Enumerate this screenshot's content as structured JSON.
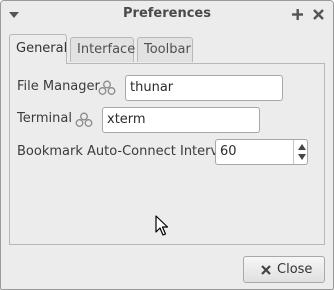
{
  "window": {
    "title": "Preferences"
  },
  "tabs": [
    {
      "label": "General",
      "active": true
    },
    {
      "label": "Interface",
      "active": false
    },
    {
      "label": "Toolbar",
      "active": false
    }
  ],
  "general": {
    "file_manager": {
      "label": "File Manager",
      "value": "thunar"
    },
    "terminal": {
      "label": "Terminal",
      "value": "xterm"
    },
    "bookmark_interval": {
      "label": "Bookmark Auto-Connect Interval",
      "value": "60"
    }
  },
  "footer": {
    "close_label": "Close"
  },
  "icons": {
    "window_menu": "chevron-down-icon",
    "maximize": "plus-icon",
    "close": "close-icon",
    "launcher": "gear-cluster-icon",
    "button_close": "close-icon"
  }
}
